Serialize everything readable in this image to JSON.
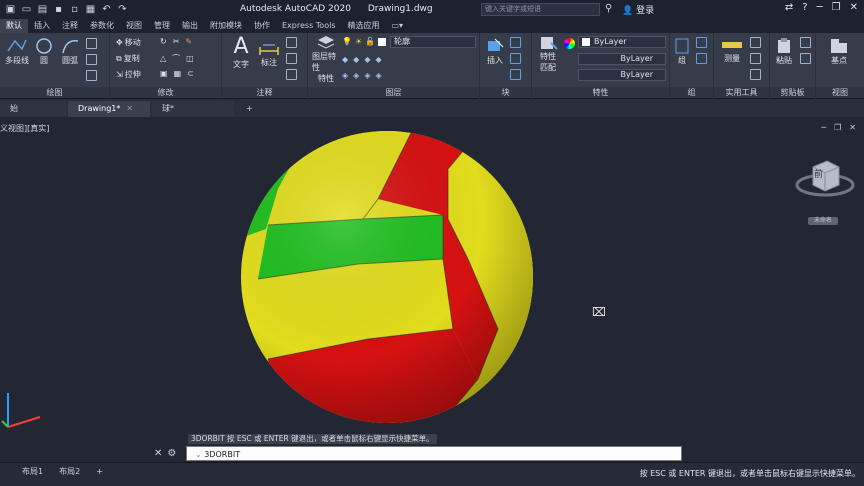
{
  "app": {
    "title": "Autodesk AutoCAD 2020",
    "file": "Drawing1.dwg",
    "search_placeholder": "键入关键字或短语",
    "user": "登录"
  },
  "ribbon_tabs": [
    "默认",
    "插入",
    "注释",
    "参数化",
    "视图",
    "管理",
    "输出",
    "附加模块",
    "协作",
    "Express Tools",
    "精选应用"
  ],
  "panels": {
    "draw": {
      "label": "绘图",
      "polyline": "多段线",
      "circle": "圆",
      "arc": "圆弧"
    },
    "modify": {
      "label": "修改",
      "move": "移动",
      "copy": "复制",
      "stretch": "拉伸"
    },
    "annotation": {
      "label": "注释",
      "text": "文字",
      "dim": "标注"
    },
    "layers": {
      "label": "图层",
      "props": "图层特性",
      "props2": "特性",
      "current": "轮廓"
    },
    "block": {
      "label": "块",
      "insert": "插入"
    },
    "properties": {
      "label": "特性",
      "match": "特性",
      "match2": "匹配",
      "color": "ByLayer",
      "linetype": "ByLayer",
      "lineweight": "ByLayer"
    },
    "groups": {
      "label": "组",
      "group": "组"
    },
    "utilities": {
      "label": "实用工具",
      "measure": "测量"
    },
    "clipboard": {
      "label": "剪贴板",
      "paste": "粘贴"
    },
    "view": {
      "label": "视图",
      "base": "基点"
    }
  },
  "doc_tabs": [
    "始",
    "Drawing1*",
    "球*"
  ],
  "viewport": {
    "label": "义视图][真实]",
    "viewcube_face": "前",
    "wcs": "未命名"
  },
  "command": {
    "hint": "3DORBIT 按 ESC 或 ENTER 键退出，或者单击鼠标右键显示快捷菜单。",
    "input": "3DORBIT"
  },
  "layout_tabs": [
    "布局1",
    "布局2"
  ],
  "status_msg": "按 ESC 或 ENTER 键退出，或者单击鼠标右键显示快捷菜单。",
  "ball_colors": {
    "green": "#1fbf1f",
    "yellow": "#e2dd1d",
    "red": "#d61111"
  }
}
